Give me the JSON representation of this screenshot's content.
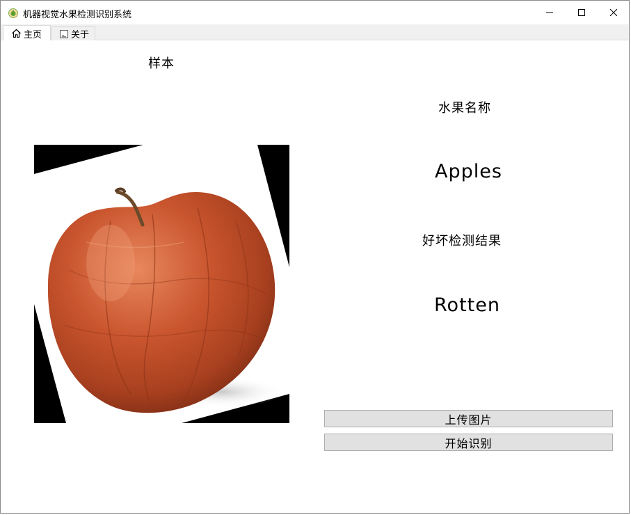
{
  "window": {
    "title": "机器视觉水果检测识别系统"
  },
  "tabs": [
    {
      "label": "主页",
      "icon": "home-icon",
      "active": true
    },
    {
      "label": "关于",
      "icon": "document-icon",
      "active": false
    }
  ],
  "main": {
    "sample_label": "样本",
    "fruit_name_label": "水果名称",
    "fruit_name_value": "Apples",
    "quality_label": "好坏检测结果",
    "quality_value": "Rotten",
    "upload_button": "上传图片",
    "start_button": "开始识别"
  },
  "colors": {
    "button_bg": "#e1e1e1",
    "button_border": "#adadad",
    "tab_strip_bg": "#f0f0f0",
    "image_bg": "#000000"
  }
}
